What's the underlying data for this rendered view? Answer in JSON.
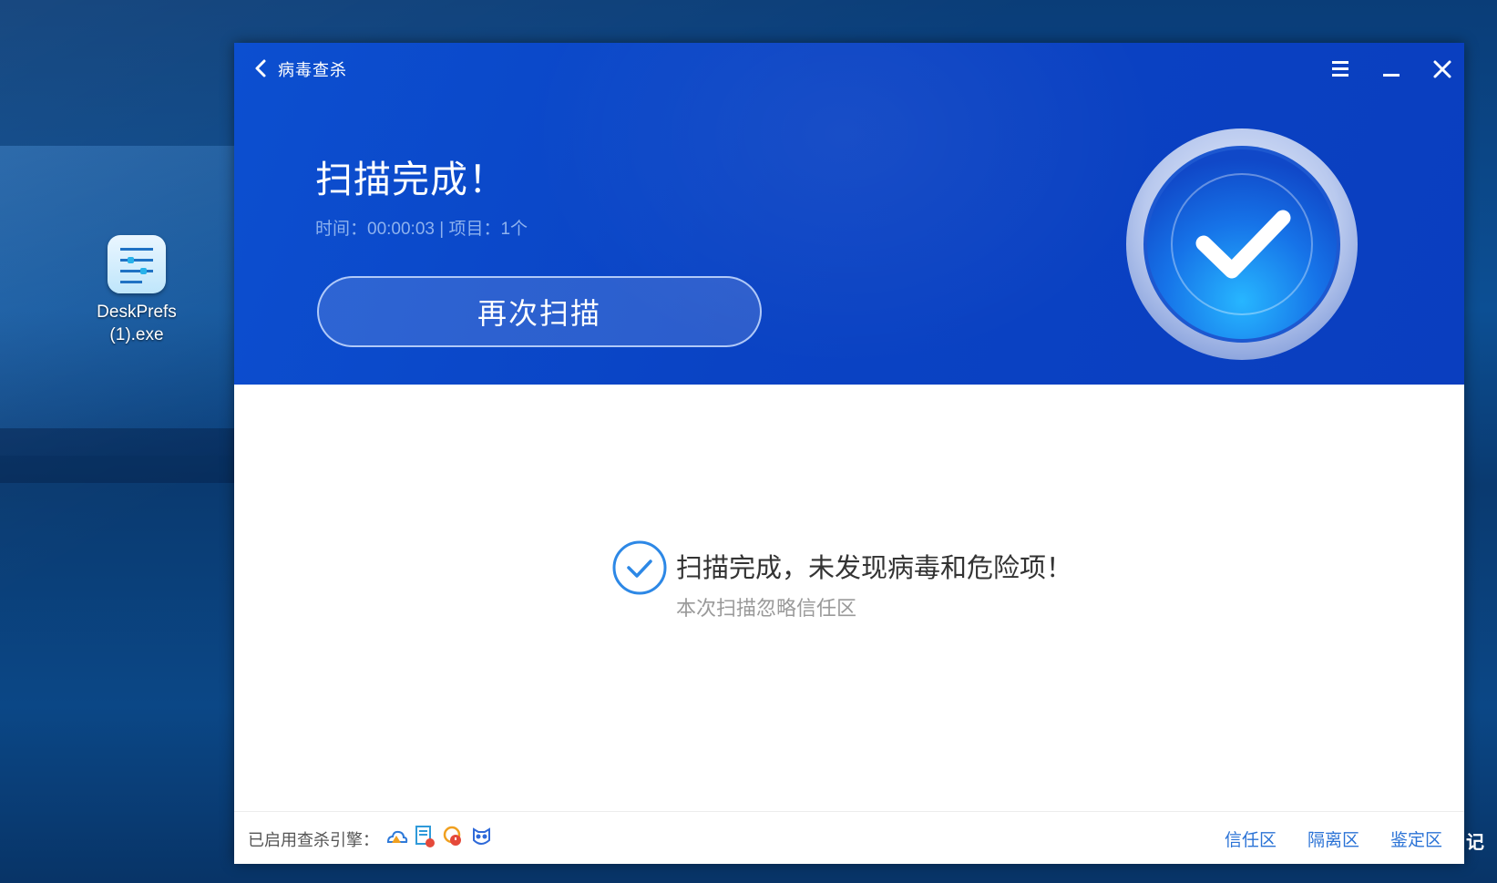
{
  "desktop": {
    "icon_label_line1": "DeskPrefs",
    "icon_label_line2": "(1).exe",
    "edge_glyph": "记"
  },
  "window": {
    "title": "病毒查杀",
    "headline": "扫描完成！",
    "subline": "时间：00:00:03 | 项目：1个",
    "rescan_label": "再次扫描"
  },
  "result": {
    "main": "扫描完成，未发现病毒和危险项！",
    "sub": "本次扫描忽略信任区"
  },
  "footer": {
    "engine_label": "已启用查杀引擎：",
    "engines": [
      "cloud-engine-icon",
      "document-engine-icon",
      "heuristic-engine-icon",
      "owl-engine-icon"
    ],
    "links": [
      "信任区",
      "隔离区",
      "鉴定区"
    ]
  },
  "colors": {
    "header_blue": "#0a43c4",
    "accent_blue": "#2b73d6",
    "check_blue": "#2d88e6"
  }
}
